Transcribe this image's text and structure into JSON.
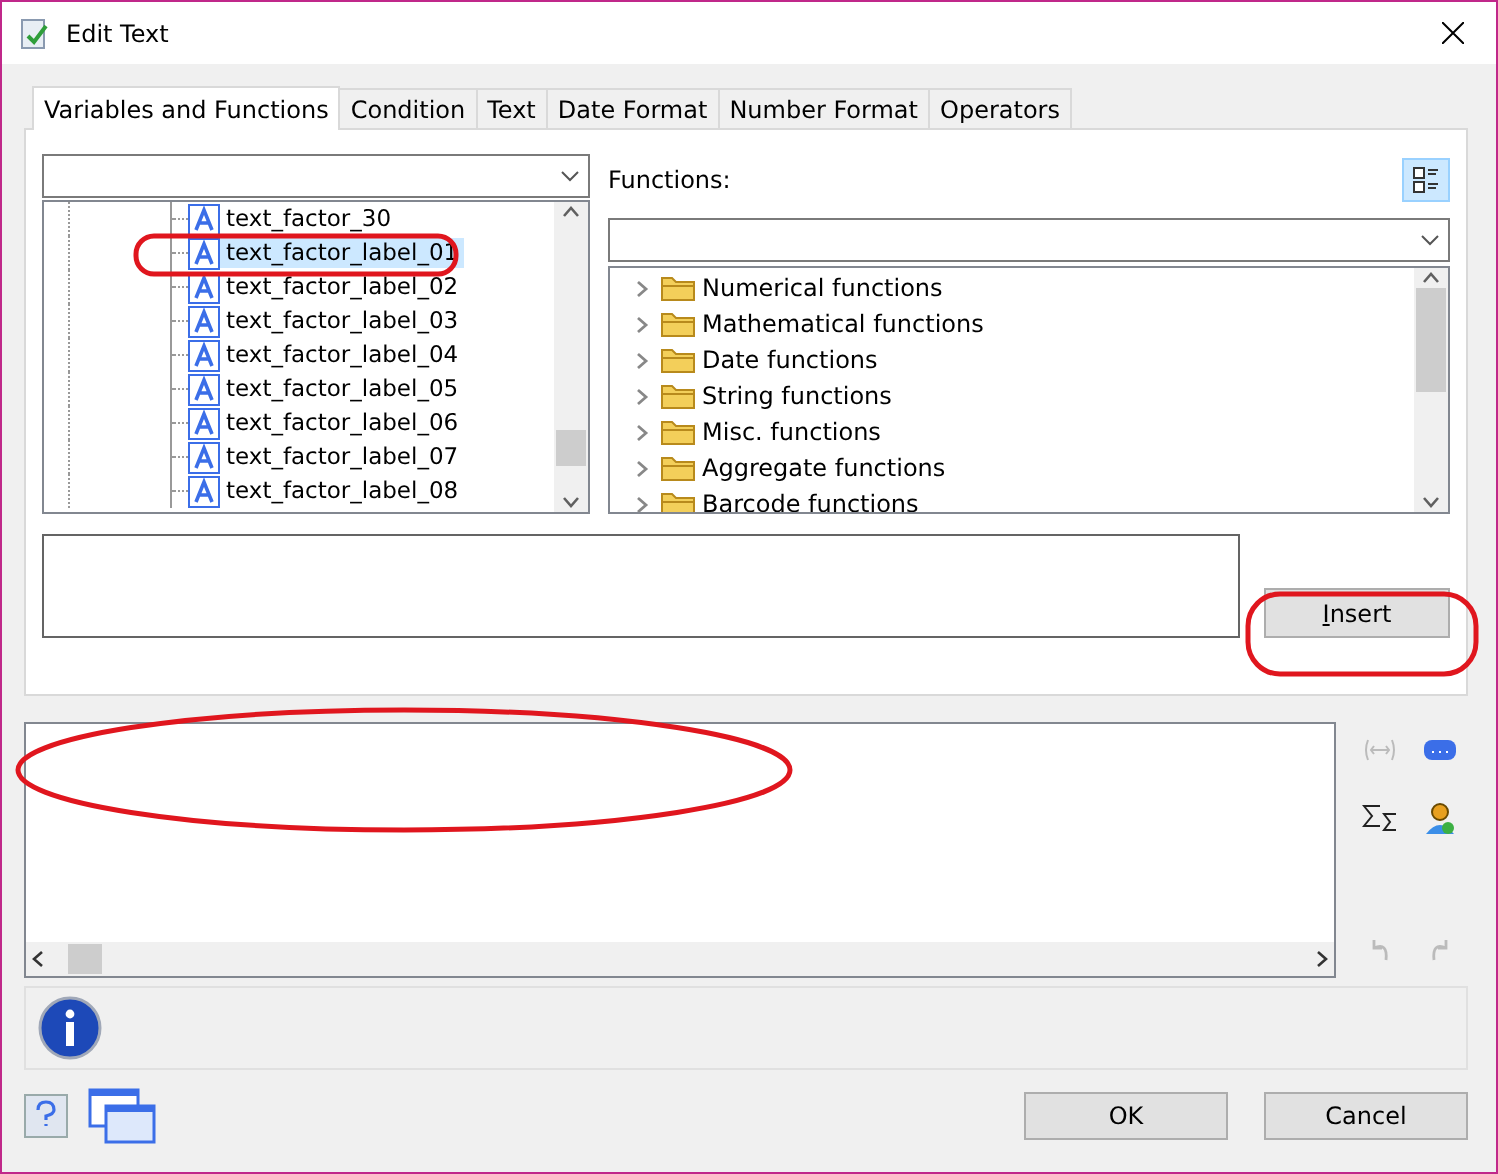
{
  "window": {
    "title": "Edit Text"
  },
  "tabs": [
    {
      "label": "Variables and Functions",
      "selected": true
    },
    {
      "label": "Condition",
      "selected": false
    },
    {
      "label": "Text",
      "selected": false
    },
    {
      "label": "Date Format",
      "selected": false
    },
    {
      "label": "Number Format",
      "selected": false
    },
    {
      "label": "Operators",
      "selected": false
    }
  ],
  "variables": {
    "items": [
      {
        "label": "text_factor_30",
        "selected": false
      },
      {
        "label": "text_factor_label_01",
        "selected": true
      },
      {
        "label": "text_factor_label_02",
        "selected": false
      },
      {
        "label": "text_factor_label_03",
        "selected": false
      },
      {
        "label": "text_factor_label_04",
        "selected": false
      },
      {
        "label": "text_factor_label_05",
        "selected": false
      },
      {
        "label": "text_factor_label_06",
        "selected": false
      },
      {
        "label": "text_factor_label_07",
        "selected": false
      },
      {
        "label": "text_factor_label_08",
        "selected": false
      }
    ]
  },
  "functions": {
    "label": "Functions:",
    "categories": [
      {
        "label": "Numerical functions",
        "expanded": false
      },
      {
        "label": "Mathematical functions",
        "expanded": false
      },
      {
        "label": "Date functions",
        "expanded": false
      },
      {
        "label": "String functions",
        "expanded": false
      },
      {
        "label": "Misc. functions",
        "expanded": false
      },
      {
        "label": "Aggregate functions",
        "expanded": false
      },
      {
        "label": "Barcode functions",
        "expanded": false
      }
    ]
  },
  "insert_button": "Insert",
  "buttons": [
    "OK",
    "Cancel"
  ]
}
